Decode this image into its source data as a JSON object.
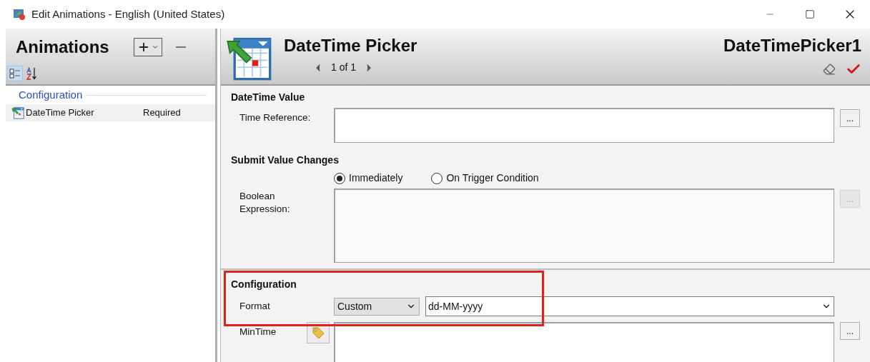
{
  "window": {
    "title": "Edit Animations - English (United States)"
  },
  "animations_panel": {
    "title": "Animations",
    "sort_buttons": [
      {
        "kind": "categorized",
        "selected": true
      },
      {
        "kind": "alphabetical",
        "selected": false
      }
    ],
    "group": "Configuration",
    "items": [
      {
        "name": "DateTime Picker",
        "status": "Required",
        "selected": true
      }
    ]
  },
  "editor": {
    "title": "DateTime Picker",
    "pager": "1 of 1",
    "object_name": "DateTimePicker1",
    "datetime_value": {
      "heading": "DateTime Value",
      "time_reference": {
        "label": "Time Reference:",
        "browse": "..."
      }
    },
    "submit_value_changes": {
      "heading": "Submit Value Changes",
      "options": [
        {
          "label": "Immediately",
          "selected": true
        },
        {
          "label": "On Trigger Condition",
          "selected": false
        }
      ],
      "boolean_expression": {
        "label": "Boolean Expression:",
        "browse": "...",
        "disabled": true
      }
    },
    "configuration": {
      "heading": "Configuration",
      "highlighted": true,
      "format": {
        "label": "Format",
        "type": "Custom",
        "value": "dd-MM-yyyy"
      },
      "min_time": {
        "label": "MinTime",
        "browse": "..."
      }
    }
  }
}
